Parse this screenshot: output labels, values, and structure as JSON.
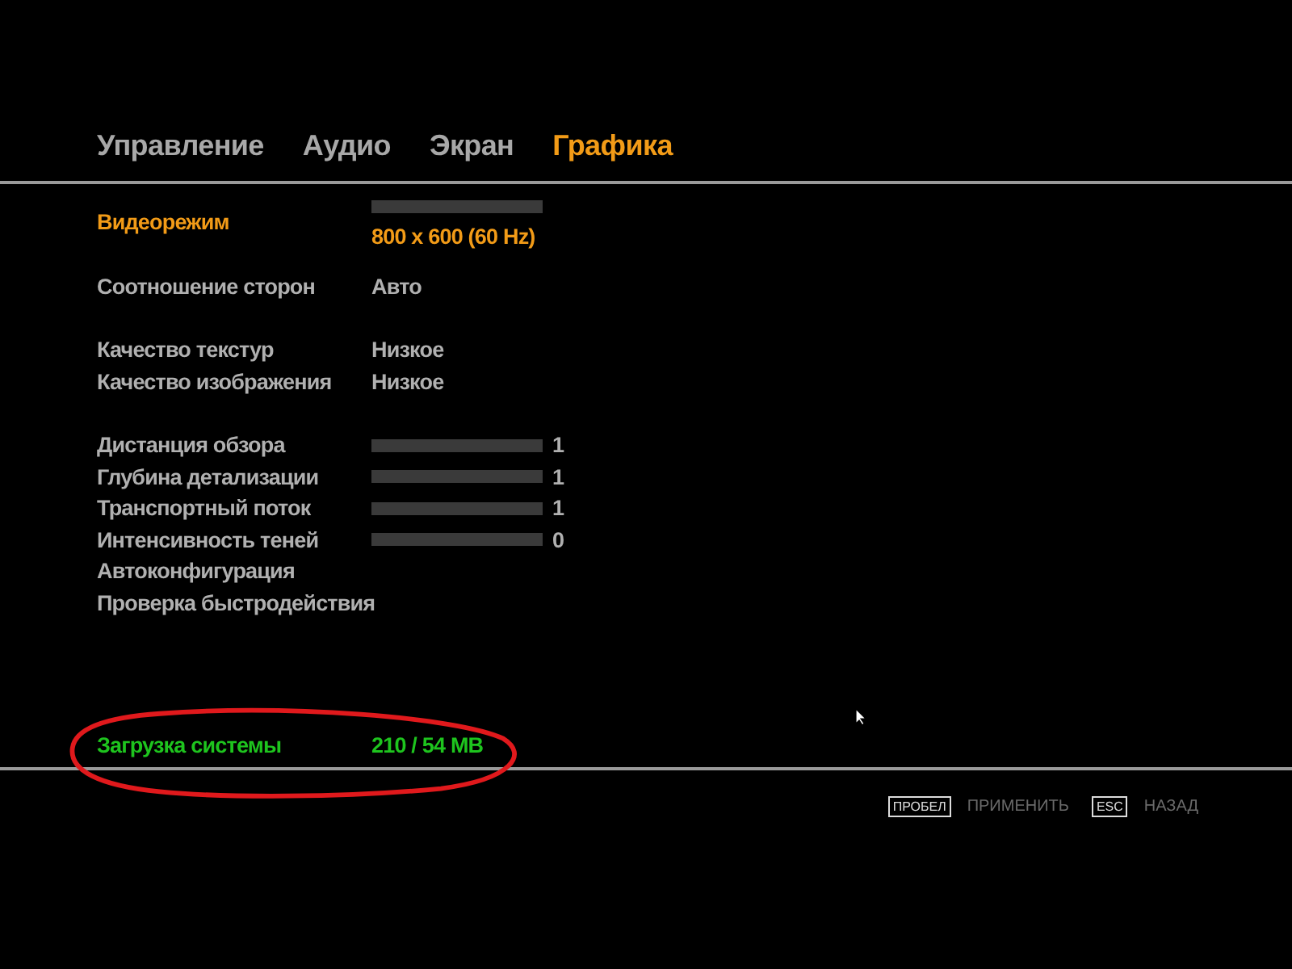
{
  "tabs": [
    {
      "label": "Управление",
      "selected": false
    },
    {
      "label": "Аудио",
      "selected": false
    },
    {
      "label": "Экран",
      "selected": false
    },
    {
      "label": "Графика",
      "selected": true
    }
  ],
  "groups": [
    [
      {
        "kind": "bar-value",
        "label": "Видеорежим",
        "value": "800 x 600 (60 Hz)",
        "selected": true
      }
    ],
    [
      {
        "kind": "text",
        "label": "Соотношение сторон",
        "value": "Авто",
        "selected": false
      }
    ],
    [
      {
        "kind": "text",
        "label": "Качество текстур",
        "value": "Низкое",
        "selected": false
      },
      {
        "kind": "text",
        "label": "Качество изображения",
        "value": "Низкое",
        "selected": false
      }
    ],
    [
      {
        "kind": "slider",
        "label": "Дистанция обзора",
        "value": "1",
        "selected": false
      },
      {
        "kind": "slider",
        "label": "Глубина детализации",
        "value": "1",
        "selected": false
      },
      {
        "kind": "slider",
        "label": "Транспортный поток",
        "value": "1",
        "selected": false
      },
      {
        "kind": "slider",
        "label": "Интенсивность теней",
        "value": "0",
        "selected": false
      },
      {
        "kind": "action",
        "label": "Автоконфигурация",
        "selected": false
      },
      {
        "kind": "action",
        "label": "Проверка быстродействия",
        "selected": false
      }
    ]
  ],
  "system_load": {
    "label": "Загрузка системы",
    "value": "210 / 54 MB",
    "circled": true
  },
  "footer": [
    {
      "key": "ПРОБЕЛ",
      "label": "ПРИМЕНИТЬ"
    },
    {
      "key": "ESC",
      "label": "НАЗАД"
    }
  ]
}
